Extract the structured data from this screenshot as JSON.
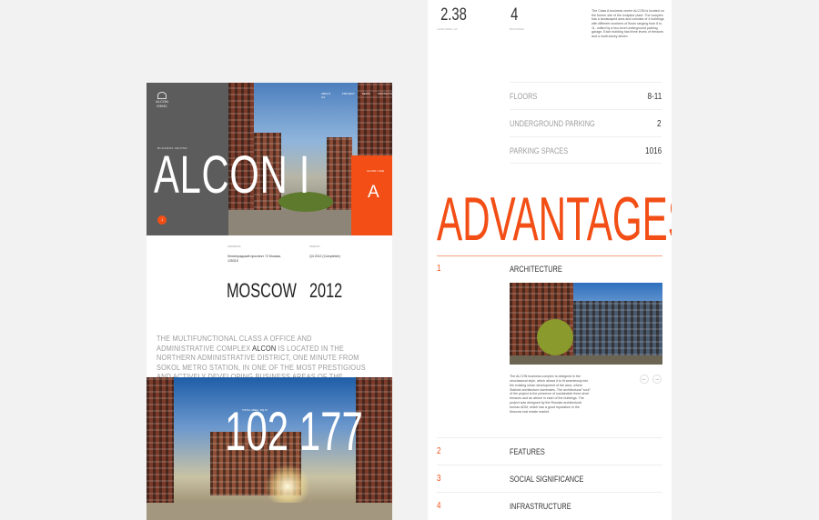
{
  "left": {
    "logo": {
      "line1": "ALCON",
      "line2": "ОФИС"
    },
    "nav": [
      "ABOUT US",
      "PROJECT",
      "NEWS",
      "CONTACTS"
    ],
    "hero_kicker": "BUSINESS CENTER",
    "hero_title": "ALCON I",
    "orange_caption": "ALCON I LIFE",
    "orange_letter": "A",
    "scroll_arrow": "↓",
    "info": {
      "address_label": "ADDRESS",
      "address_value": "Ленинградский проспект 72 Москва, 125315",
      "period_label": "PERIOD",
      "period_value": "Q4 2012 (Completed)",
      "city": "MOSCOW",
      "year": "2012"
    },
    "description_pre": "THE MULTIFUNCTIONAL CLASS A OFFICE AND ADMINISTRATIVE COMPLEX ",
    "description_brand": "ALCON",
    "description_post": " IS LOCATED IN THE NORTHERN ADMINISTRATIVE DISTRICT, ONE MINUTE FROM SOKOL METRO STATION, IN ONE OF THE MOST PRESTIGIOUS AND ACTIVELY DEVELOPING BUSINESS AREAS OF THE CAPITAL",
    "photo2_label": "TOTAL AREA, SQ M",
    "photo2_number": "102 177"
  },
  "right": {
    "stats": [
      {
        "value": "2.38",
        "label": "LAND AREA, HA"
      },
      {
        "value": "4",
        "label": "BUILDINGS"
      }
    ],
    "stats_description": "The Class A business centre ALCON is located on the former site of the Izolyator plant. The complex has a landscaped area and consists of 4 buildings with different numbers of floors ranging from 8 to 11, united by a two-level underground parking garage. Each building has three levels of terraces and a multi-storey atrium.",
    "specs": [
      {
        "label": "FLOORS",
        "value": "8-11"
      },
      {
        "label": "UNDERGROUND PARKING",
        "value": "2"
      },
      {
        "label": "PARKING SPACES",
        "value": "1016"
      }
    ],
    "advantages_title": "ADVANTAGES",
    "accordion": [
      {
        "num": "1",
        "title": "ARCHITECTURE"
      },
      {
        "num": "2",
        "title": "FEATURES"
      },
      {
        "num": "3",
        "title": "SOCIAL SIGNIFICANCE"
      },
      {
        "num": "4",
        "title": "INFRASTRUCTURE"
      }
    ],
    "architecture_text": "The ALCON business complex is designed in the neoclassical style, which allows it to fit seamlessly into the existing urban development of the area, where Stalinist architecture dominates. The architectural “soul” of the project is the presence of sustainable three-level terraces and an atrium in each of the buildings. The project was designed by the Russian architectural bureau ADM, which has a good reputation in the Moscow real estate market.",
    "prev_arrow": "←",
    "next_arrow": "→"
  },
  "colors": {
    "accent": "#f24e15",
    "hero_grey": "#5c5c5c",
    "background": "#f2f2f2"
  }
}
